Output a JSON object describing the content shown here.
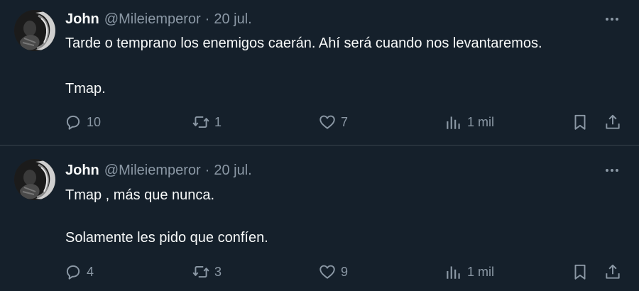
{
  "tweets": [
    {
      "author_name": "John",
      "author_handle": "@Mileiemperor",
      "separator": "·",
      "date": "20 jul.",
      "lines": [
        "Tarde o temprano los enemigos caerán. Ahí será cuando nos levantaremos.",
        "Tmap."
      ],
      "replies": "10",
      "reposts": "1",
      "likes": "7",
      "views": "1 mil",
      "icons": {
        "more": "more-horizontal-icon",
        "reply": "reply-icon",
        "repost": "repost-icon",
        "like": "heart-icon",
        "views": "views-chart-icon",
        "bookmark": "bookmark-icon",
        "share": "share-icon"
      }
    },
    {
      "author_name": "John",
      "author_handle": "@Mileiemperor",
      "separator": "·",
      "date": "20 jul.",
      "lines": [
        "Tmap , más que nunca.",
        "Solamente les pido que confíen."
      ],
      "replies": "4",
      "reposts": "3",
      "likes": "9",
      "views": "1 mil",
      "icons": {
        "more": "more-horizontal-icon",
        "reply": "reply-icon",
        "repost": "repost-icon",
        "like": "heart-icon",
        "views": "views-chart-icon",
        "bookmark": "bookmark-icon",
        "share": "share-icon"
      }
    }
  ],
  "colors": {
    "background": "#15202b",
    "divider": "#38444d",
    "primary_text": "#f7f9f9",
    "secondary_text": "#8b98a5"
  }
}
